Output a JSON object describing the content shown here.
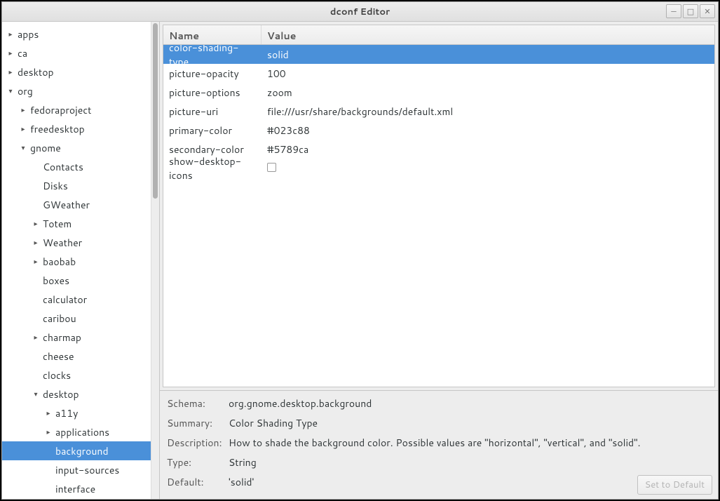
{
  "window": {
    "title": "dconf Editor"
  },
  "winbuttons": {
    "min": "—",
    "max": "□",
    "close": "✕"
  },
  "tree": {
    "items": [
      {
        "label": "apps",
        "indent": 0,
        "expander": "▸"
      },
      {
        "label": "ca",
        "indent": 0,
        "expander": "▸"
      },
      {
        "label": "desktop",
        "indent": 0,
        "expander": "▸"
      },
      {
        "label": "org",
        "indent": 0,
        "expander": "▾"
      },
      {
        "label": "fedoraproject",
        "indent": 1,
        "expander": "▸"
      },
      {
        "label": "freedesktop",
        "indent": 1,
        "expander": "▸"
      },
      {
        "label": "gnome",
        "indent": 1,
        "expander": "▾"
      },
      {
        "label": "Contacts",
        "indent": 2,
        "expander": ""
      },
      {
        "label": "Disks",
        "indent": 2,
        "expander": ""
      },
      {
        "label": "GWeather",
        "indent": 2,
        "expander": ""
      },
      {
        "label": "Totem",
        "indent": 2,
        "expander": "▸"
      },
      {
        "label": "Weather",
        "indent": 2,
        "expander": "▸"
      },
      {
        "label": "baobab",
        "indent": 2,
        "expander": "▸"
      },
      {
        "label": "boxes",
        "indent": 2,
        "expander": ""
      },
      {
        "label": "calculator",
        "indent": 2,
        "expander": ""
      },
      {
        "label": "caribou",
        "indent": 2,
        "expander": ""
      },
      {
        "label": "charmap",
        "indent": 2,
        "expander": "▸"
      },
      {
        "label": "cheese",
        "indent": 2,
        "expander": ""
      },
      {
        "label": "clocks",
        "indent": 2,
        "expander": ""
      },
      {
        "label": "desktop",
        "indent": 2,
        "expander": "▾"
      },
      {
        "label": "a11y",
        "indent": 3,
        "expander": "▸"
      },
      {
        "label": "applications",
        "indent": 3,
        "expander": "▸"
      },
      {
        "label": "background",
        "indent": 3,
        "expander": "",
        "selected": true
      },
      {
        "label": "input-sources",
        "indent": 3,
        "expander": ""
      },
      {
        "label": "interface",
        "indent": 3,
        "expander": ""
      }
    ]
  },
  "table": {
    "headers": {
      "name": "Name",
      "value": "Value"
    },
    "rows": [
      {
        "name": "color-shading-type",
        "value": "solid",
        "selected": true
      },
      {
        "name": "picture-opacity",
        "value": "100"
      },
      {
        "name": "picture-options",
        "value": "zoom"
      },
      {
        "name": "picture-uri",
        "value": "file:///usr/share/backgrounds/default.xml"
      },
      {
        "name": "primary-color",
        "value": "#023c88"
      },
      {
        "name": "secondary-color",
        "value": "#5789ca"
      },
      {
        "name": "show-desktop-icons",
        "value": "",
        "checkbox": true
      }
    ]
  },
  "details": {
    "schema": {
      "label": "Schema:",
      "value": "org.gnome.desktop.background"
    },
    "summary": {
      "label": "Summary:",
      "value": "Color Shading Type"
    },
    "description": {
      "label": "Description:",
      "value": "How to shade the background color. Possible values are \"horizontal\", \"vertical\", and \"solid\"."
    },
    "type": {
      "label": "Type:",
      "value": "String"
    },
    "default": {
      "label": "Default:",
      "value": "'solid'"
    },
    "set_default_button": "Set to Default"
  }
}
